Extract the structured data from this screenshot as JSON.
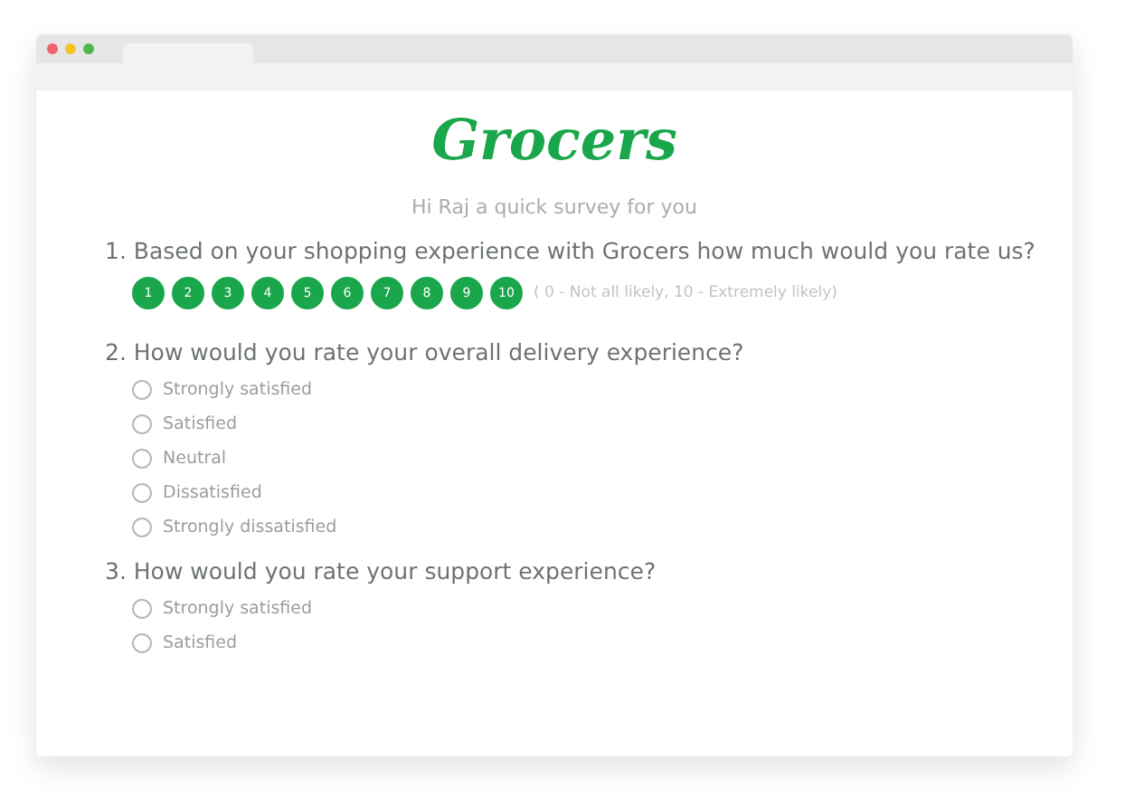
{
  "logo": "Grocers",
  "greeting": "Hi Raj a quick survey for you",
  "questions": [
    {
      "kind": "scale",
      "text": "1. Based on your shopping experience with Grocers how much would you rate us?",
      "options": [
        {
          "label": "1",
          "selected": false
        },
        {
          "label": "2",
          "selected": false
        },
        {
          "label": "3",
          "selected": false
        },
        {
          "label": "4",
          "selected": false
        },
        {
          "label": "5",
          "selected": false
        },
        {
          "label": "6",
          "selected": false
        },
        {
          "label": "7",
          "selected": false
        },
        {
          "label": "8",
          "selected": false
        },
        {
          "label": "9",
          "selected": false
        },
        {
          "label": "10",
          "selected": false
        }
      ],
      "hint": "( 0 - Not all likely, 10 - Extremely likely)"
    },
    {
      "kind": "radio",
      "text": "2. How would you rate your overall delivery experience?",
      "options": [
        {
          "label": "Strongly satisfied",
          "selected": false
        },
        {
          "label": "Satisfied",
          "selected": false
        },
        {
          "label": "Neutral",
          "selected": false
        },
        {
          "label": "Dissatisfied",
          "selected": false
        },
        {
          "label": "Strongly dissatisfied",
          "selected": false
        }
      ]
    },
    {
      "kind": "radio",
      "text": "3. How would you rate your support experience?",
      "options": [
        {
          "label": "Strongly satisfied",
          "selected": false
        },
        {
          "label": "Satisfied",
          "selected": false
        }
      ]
    }
  ]
}
